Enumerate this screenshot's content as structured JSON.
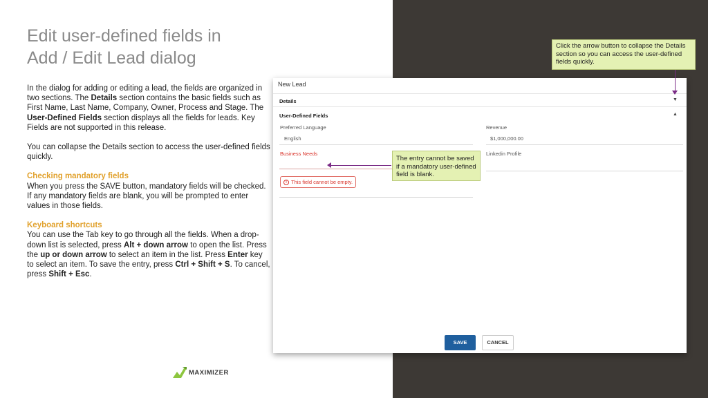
{
  "slide": {
    "title_line1": "Edit user-defined fields in",
    "title_line2": "Add / Edit Lead dialog"
  },
  "body": {
    "p1_a": "In the dialog for adding or editing a lead, the fields are organized in two sections. The ",
    "p1_b": "Details",
    "p1_c": " section contains the basic fields such as First Name, Last Name, Company, Owner, Process and Stage. The ",
    "p1_d": "User-Defined Fields",
    "p1_e": " section displays all the fields for leads. Key Fields are not supported in this release.",
    "p2": "You can collapse the Details section to access the user-defined fields quickly.",
    "h3": "Checking mandatory fields",
    "p3": "When you press the SAVE button, mandatory fields will be checked. If any mandatory fields are blank, you will be prompted to enter values in those fields.",
    "h4": "Keyboard shortcuts",
    "p4_a": "You can use the Tab key to go through all the fields. When a drop-down list is selected, press ",
    "p4_b": "Alt + down arrow",
    "p4_c": " to open the list. Press the ",
    "p4_d": "up or down arrow",
    "p4_e": " to select an item in the list. Press ",
    "p4_f": "Enter",
    "p4_g": " key to select an item. To save the entry, press ",
    "p4_h": "Ctrl + Shift + S",
    "p4_i": ". To cancel, press ",
    "p4_j": "Shift + Esc",
    "p4_k": "."
  },
  "callouts": {
    "collapse": "Click the arrow button to collapse the Details section so you can access the user-defined fields quickly.",
    "mandatory": "The entry cannot be saved if a mandatory user-defined field is blank."
  },
  "dialog": {
    "title": "New Lead",
    "details_label": "Details",
    "udf_label": "User-Defined Fields",
    "details_caret": "▼",
    "udf_caret": "▲",
    "fields": {
      "preferred_language_label": "Preferred Language",
      "preferred_language_value": "English",
      "revenue_label": "Revenue",
      "revenue_value": "$1,000,000.00",
      "business_needs_label": "Business Needs",
      "linkedin_label": "Linkedin Profile"
    },
    "error_icon": "!",
    "error_message": "This field cannot be empty.",
    "save_label": "SAVE",
    "cancel_label": "CANCEL"
  },
  "logo": {
    "text": "MAXIMIZER",
    "color": "#8dc63f"
  },
  "colors": {
    "dark_panel": "#3d3935",
    "heading_accent": "#e1a12c",
    "callout_bg": "#e4f1b3",
    "arrow": "#7b2c86",
    "error": "#d9342b",
    "save_button": "#1f5f9e"
  }
}
